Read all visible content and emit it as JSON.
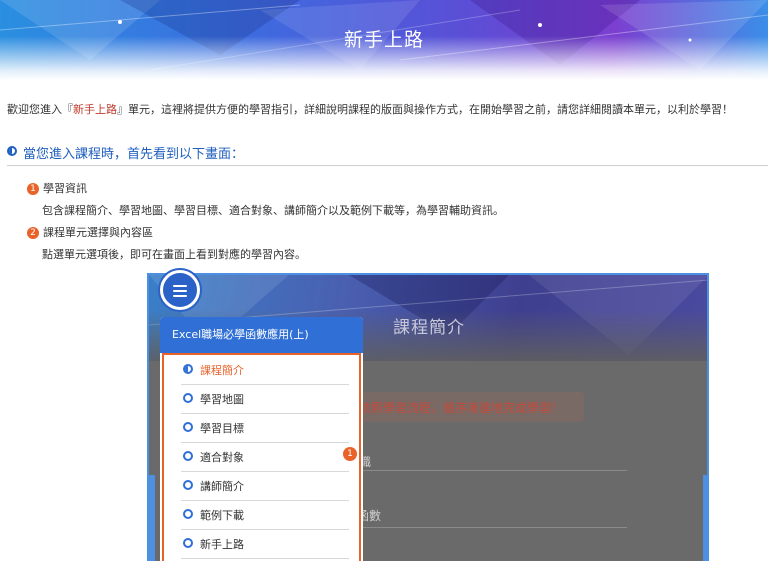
{
  "banner": {
    "title": "新手上路"
  },
  "intro": {
    "prefix": "歡迎您進入『",
    "highlight": "新手上路",
    "suffix": "』單元，這裡將提供方便的學習指引，詳細說明課程的版面與操作方式，在開始學習之前，請您詳細閱讀本單元，以利於學習！"
  },
  "section": {
    "heading": "當您進入課程時，首先看到以下畫面："
  },
  "items": [
    {
      "number": "1",
      "title": "學習資訊",
      "description": "包含課程簡介、學習地圖、學習目標、適合對象、講師簡介以及範例下載等，為學習輔助資訊。"
    },
    {
      "number": "2",
      "title": "課程單元選擇與內容區",
      "description": "點選單元選項後，即可在畫面上看到對應的學習內容。"
    }
  ],
  "screenshot": {
    "page_title": "課程簡介",
    "notice": "依照學習流程，循序漸進地完成學習！",
    "fragment_1": "職",
    "fragment_2": "函數",
    "menu_icon": "hamburger-icon",
    "course_title": "Excel職場必學函數應用(上)",
    "menu_items": [
      "課程簡介",
      "學習地圖",
      "學習目標",
      "適合對象",
      "講師簡介",
      "範例下載",
      "新手上路"
    ],
    "active_index": 0,
    "badge": "1"
  },
  "colors": {
    "accent_orange": "#e8622a",
    "primary_blue": "#2f6fd6",
    "heading_blue": "#1f5fbf",
    "highlight_red": "#c0392b"
  }
}
